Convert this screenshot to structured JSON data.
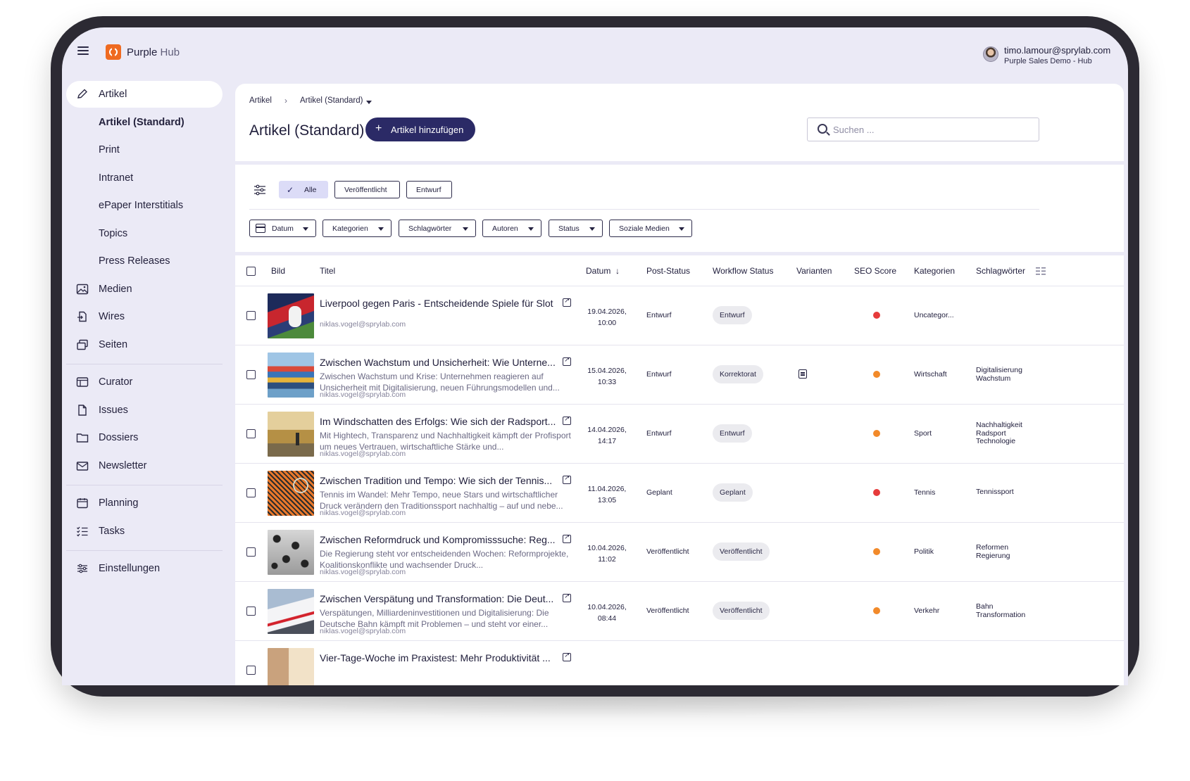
{
  "app": {
    "name": "Purple",
    "name_suffix": "Hub"
  },
  "user": {
    "email": "timo.lamour@sprylab.com",
    "org": "Purple Sales Demo - Hub"
  },
  "sidebar": {
    "items": [
      {
        "label": "Artikel",
        "icon": "pencil-icon"
      },
      {
        "label": "Artikel (Standard)"
      },
      {
        "label": "Print"
      },
      {
        "label": "Intranet"
      },
      {
        "label": "ePaper Interstitials"
      },
      {
        "label": "Topics"
      },
      {
        "label": "Press Releases"
      },
      {
        "label": "Medien",
        "icon": "image-icon"
      },
      {
        "label": "Wires",
        "icon": "wire-icon"
      },
      {
        "label": "Seiten",
        "icon": "pages-icon"
      },
      {
        "label": "Curator",
        "icon": "curator-icon"
      },
      {
        "label": "Issues",
        "icon": "document-icon"
      },
      {
        "label": "Dossiers",
        "icon": "folder-icon"
      },
      {
        "label": "Newsletter",
        "icon": "mail-icon"
      },
      {
        "label": "Planning",
        "icon": "calendar-icon"
      },
      {
        "label": "Tasks",
        "icon": "list-check-icon"
      },
      {
        "label": "Einstellungen",
        "icon": "sliders-icon"
      }
    ]
  },
  "breadcrumb": {
    "root": "Artikel",
    "current": "Artikel (Standard)"
  },
  "page": {
    "title": "Artikel (Standard)",
    "add_label": "Artikel hinzufügen"
  },
  "search": {
    "placeholder": "Suchen ..."
  },
  "status_filters": [
    {
      "label": "Alle",
      "active": true
    },
    {
      "label": "Veröffentlicht",
      "active": false
    },
    {
      "label": "Entwurf",
      "active": false
    }
  ],
  "dropdown_filters": [
    "Datum",
    "Kategorien",
    "Schlagwörter",
    "Autoren",
    "Status",
    "Soziale Medien"
  ],
  "table": {
    "columns": [
      "Bild",
      "Titel",
      "Datum",
      "Post-Status",
      "Workflow Status",
      "Varianten",
      "SEO Score",
      "Kategorien",
      "Schlagwörter"
    ],
    "rows": [
      {
        "title": "Liverpool gegen Paris - Entscheidende Spiele für Slot",
        "excerpt": "",
        "author": "niklas.vogel@sprylab.com",
        "date": "19.04.2026,",
        "time": "10:00",
        "post_status": "Entwurf",
        "workflow": "Entwurf",
        "has_variant": false,
        "seo": "red",
        "category": "Uncategor...",
        "tags": []
      },
      {
        "title": "Zwischen Wachstum und Unsicherheit: Wie Unterne...",
        "excerpt": "Zwischen Wachstum und Krise: Unternehmen reagieren auf Unsicherheit mit Digitalisierung, neuen Führungsmodellen und...",
        "author": "niklas.vogel@sprylab.com",
        "date": "15.04.2026,",
        "time": "10:33",
        "post_status": "Entwurf",
        "workflow": "Korrektorat",
        "has_variant": true,
        "seo": "orange",
        "category": "Wirtschaft",
        "tags": [
          "Digitalisierung",
          "Wachstum"
        ]
      },
      {
        "title": "Im Windschatten des Erfolgs: Wie sich der Radsport...",
        "excerpt": "Mit Hightech, Transparenz und Nachhaltigkeit kämpft der Profisport um neues Vertrauen, wirtschaftliche Stärke und...",
        "author": "niklas.vogel@sprylab.com",
        "date": "14.04.2026,",
        "time": "14:17",
        "post_status": "Entwurf",
        "workflow": "Entwurf",
        "has_variant": false,
        "seo": "orange",
        "category": "Sport",
        "tags": [
          "Nachhaltigkeit",
          "Radsport",
          "Technologie"
        ]
      },
      {
        "title": "Zwischen Tradition und Tempo: Wie sich der Tennis...",
        "excerpt": "Tennis im Wandel: Mehr Tempo, neue Stars und wirtschaftlicher Druck verändern den Traditionssport nachhaltig – auf und nebe...",
        "author": "niklas.vogel@sprylab.com",
        "date": "11.04.2026,",
        "time": "13:05",
        "post_status": "Geplant",
        "workflow": "Geplant",
        "has_variant": false,
        "seo": "red",
        "category": "Tennis",
        "tags": [
          "Tennissport"
        ]
      },
      {
        "title": "Zwischen Reformdruck und Kompromisssuche: Reg...",
        "excerpt": "Die Regierung steht vor entscheidenden Wochen: Reformprojekte, Koalitionskonflikte und wachsender Druck...",
        "author": "niklas.vogel@sprylab.com",
        "date": "10.04.2026,",
        "time": "11:02",
        "post_status": "Veröffentlicht",
        "workflow": "Veröffentlicht",
        "has_variant": false,
        "seo": "orange",
        "category": "Politik",
        "tags": [
          "Reformen",
          "Regierung"
        ]
      },
      {
        "title": "Zwischen Verspätung und Transformation: Die Deut...",
        "excerpt": "Verspätungen, Milliardeninvestitionen und Digitalisierung: Die Deutsche Bahn kämpft mit Problemen – und steht vor einer...",
        "author": "niklas.vogel@sprylab.com",
        "date": "10.04.2026,",
        "time": "08:44",
        "post_status": "Veröffentlicht",
        "workflow": "Veröffentlicht",
        "has_variant": false,
        "seo": "orange",
        "category": "Verkehr",
        "tags": [
          "Bahn",
          "Transformation"
        ]
      },
      {
        "title": "Vier-Tage-Woche im Praxistest: Mehr Produktivität ...",
        "excerpt": "",
        "author": "",
        "date": "",
        "time": "",
        "post_status": "",
        "workflow": "",
        "has_variant": false,
        "seo": "",
        "category": "",
        "tags": []
      }
    ]
  },
  "colors": {
    "accent": "#2b2a66",
    "brand": "#ef6a21",
    "seo_red": "#e63b3b",
    "seo_orange": "#f28a2a"
  }
}
